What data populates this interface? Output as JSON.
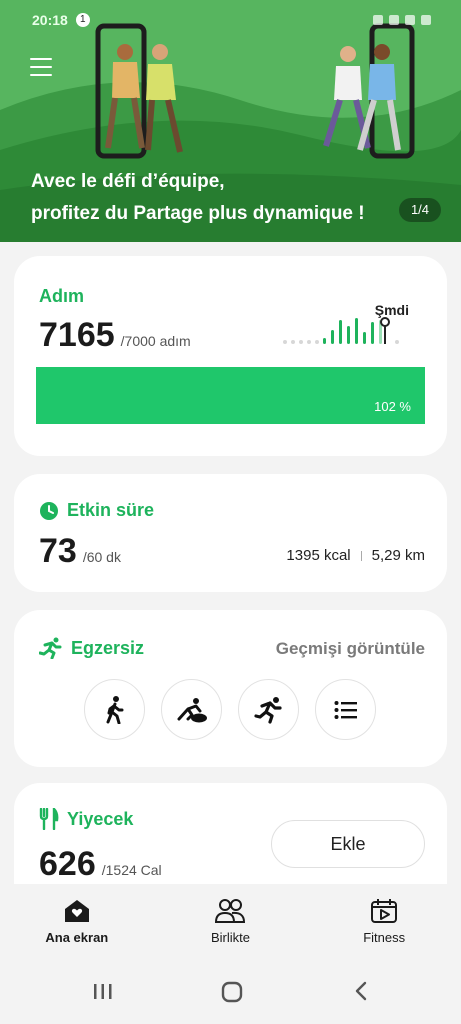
{
  "status_bar": {
    "time": "20:18",
    "notification_count": "1"
  },
  "hero": {
    "headline_line1": "Avec le défi d’équipe,",
    "headline_line2": "profitez du Partage plus dynamique !",
    "page_counter": "1/4"
  },
  "steps": {
    "title": "Adım",
    "value": "7165",
    "goal": "/7000 adım",
    "now_label": "Şmdi",
    "progress_percent": 102,
    "progress_label": "102 %",
    "accent_color": "#1fc76b"
  },
  "active_time": {
    "title": "Etkin süre",
    "value": "73",
    "goal": "/60 dk",
    "calories": "1395 kcal",
    "distance": "5,29 km",
    "icon": "clock-icon"
  },
  "exercise": {
    "title": "Egzersiz",
    "history_link": "Geçmişi görüntüle",
    "icon": "running-icon",
    "buttons": [
      {
        "name": "walking",
        "icon": "walking-icon"
      },
      {
        "name": "hiking",
        "icon": "hiking-icon"
      },
      {
        "name": "running",
        "icon": "running-icon"
      },
      {
        "name": "list",
        "icon": "list-icon"
      }
    ]
  },
  "food": {
    "title": "Yiyecek",
    "value": "626",
    "goal": "/1524 Cal",
    "add_label": "Ekle",
    "icon": "fork-knife-icon"
  },
  "bottom_nav": {
    "items": [
      {
        "label": "Ana ekran",
        "icon": "home-heart-icon"
      },
      {
        "label": "Birlikte",
        "icon": "people-icon"
      },
      {
        "label": "Fitness",
        "icon": "video-calendar-icon"
      }
    ]
  }
}
